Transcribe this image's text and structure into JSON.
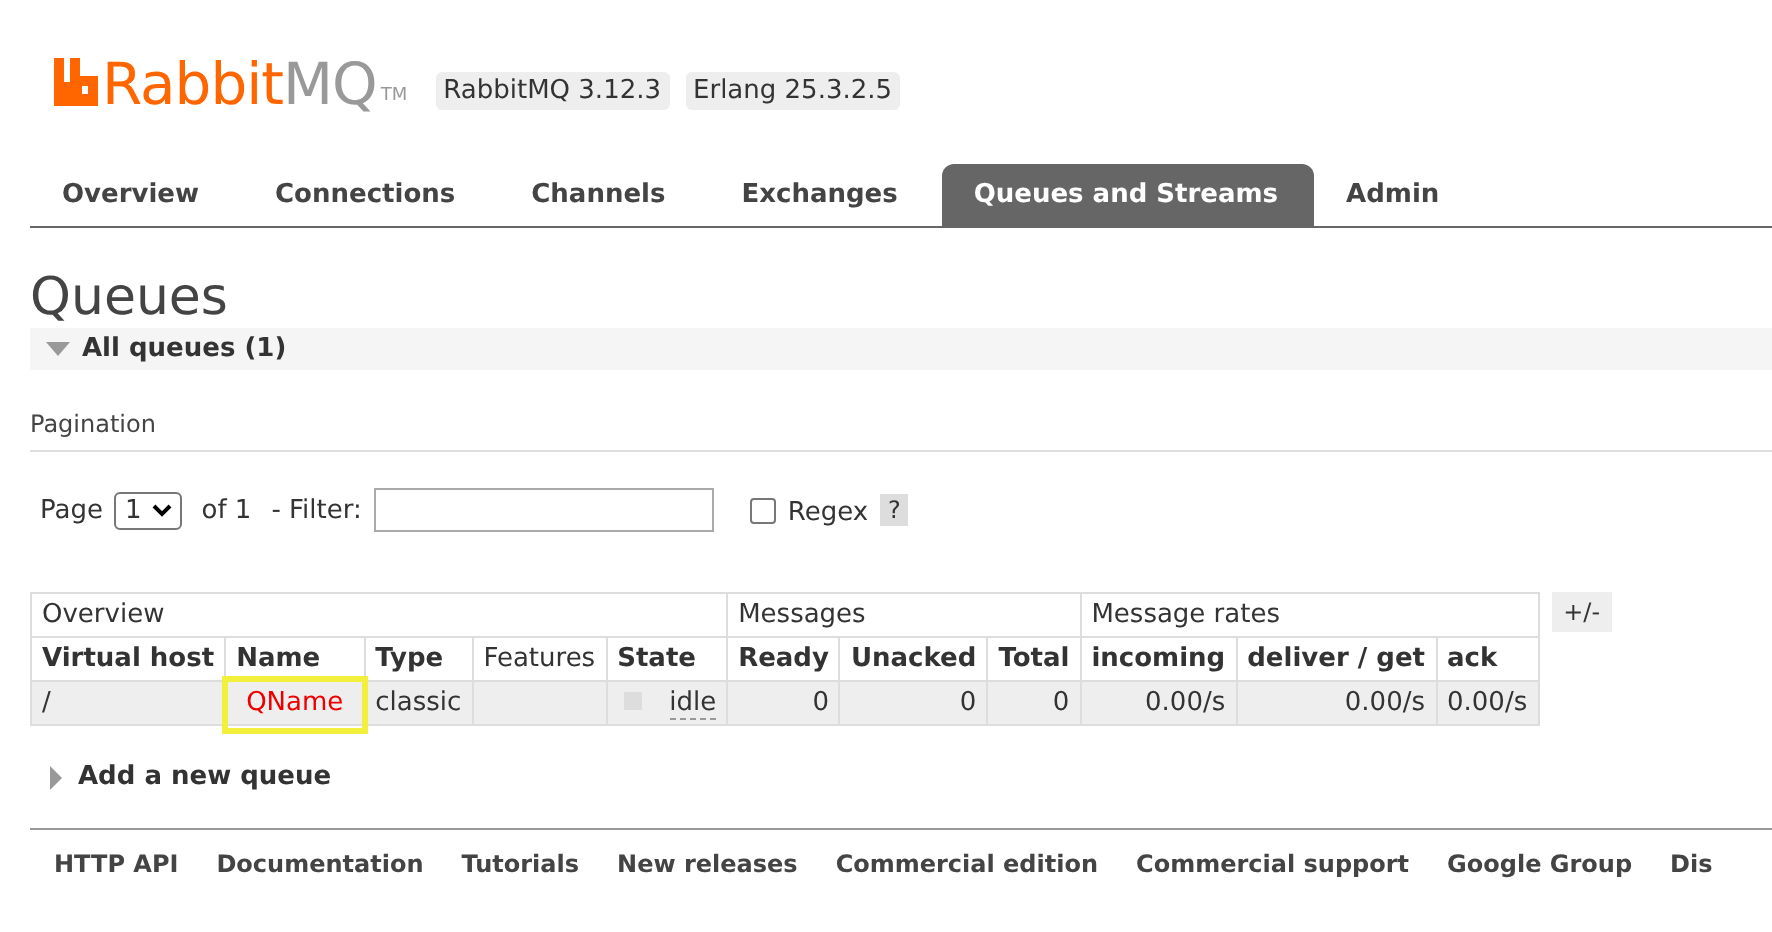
{
  "header": {
    "logo": {
      "rabbit": "Rabbit",
      "mq": "MQ",
      "tm": "TM"
    },
    "versions": [
      "RabbitMQ 3.12.3",
      "Erlang 25.3.2.5"
    ]
  },
  "tabs": [
    {
      "label": "Overview",
      "selected": false
    },
    {
      "label": "Connections",
      "selected": false
    },
    {
      "label": "Channels",
      "selected": false
    },
    {
      "label": "Exchanges",
      "selected": false
    },
    {
      "label": "Queues and Streams",
      "selected": true
    },
    {
      "label": "Admin",
      "selected": false
    }
  ],
  "page_title": "Queues",
  "section": {
    "title": "All queues (1)",
    "expanded": true
  },
  "pagination": {
    "heading": "Pagination",
    "page_label": "Page",
    "page_value": "1",
    "of_label": "of 1",
    "filter_label": "- Filter:",
    "regex_label": "Regex",
    "regex_checked": false,
    "help": "?"
  },
  "table": {
    "groups": [
      {
        "label": "Overview",
        "columns": [
          "Virtual host",
          "Name",
          "Type",
          "Features",
          "State"
        ]
      },
      {
        "label": "Messages",
        "columns": [
          "Ready",
          "Unacked",
          "Total"
        ]
      },
      {
        "label": "Message rates",
        "columns": [
          "incoming",
          "deliver / get",
          "ack"
        ]
      }
    ],
    "rows": [
      {
        "virtual_host": "/",
        "name": "QName",
        "type": "classic",
        "state": "idle",
        "ready": "0",
        "unacked": "0",
        "total": "0",
        "incoming": "0.00/s",
        "deliver_get": "0.00/s",
        "ack": "0.00/s",
        "highlighted": true
      }
    ],
    "toggle_columns": "+/-"
  },
  "add_section": {
    "title": "Add a new queue",
    "expanded": false
  },
  "footer": [
    "HTTP API",
    "Documentation",
    "Tutorials",
    "New releases",
    "Commercial edition",
    "Commercial support",
    "Google Group",
    "Dis"
  ]
}
